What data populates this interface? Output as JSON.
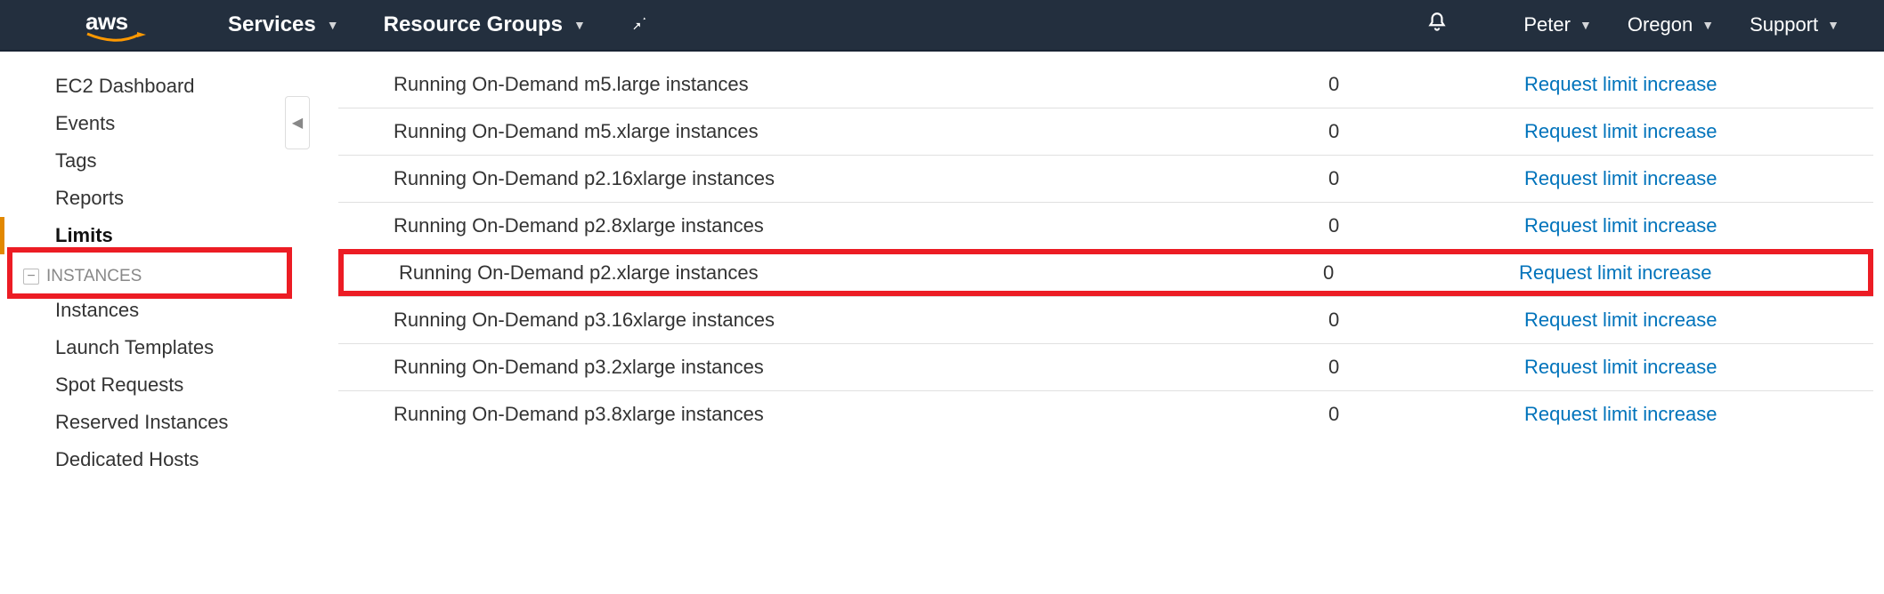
{
  "header": {
    "logo_text": "aws",
    "services": "Services",
    "resource_groups": "Resource Groups",
    "user": "Peter",
    "region": "Oregon",
    "support": "Support"
  },
  "sidebar": {
    "items": [
      "EC2 Dashboard",
      "Events",
      "Tags",
      "Reports",
      "Limits"
    ],
    "active_index": 4,
    "section_label": "INSTANCES",
    "section_items": [
      "Instances",
      "Launch Templates",
      "Spot Requests",
      "Reserved Instances",
      "Dedicated Hosts"
    ]
  },
  "table": {
    "link_label": "Request limit increase",
    "rows": [
      {
        "name": "Running On-Demand m5.large instances",
        "value": "0",
        "highlight": false
      },
      {
        "name": "Running On-Demand m5.xlarge instances",
        "value": "0",
        "highlight": false
      },
      {
        "name": "Running On-Demand p2.16xlarge instances",
        "value": "0",
        "highlight": false
      },
      {
        "name": "Running On-Demand p2.8xlarge instances",
        "value": "0",
        "highlight": false
      },
      {
        "name": "Running On-Demand p2.xlarge instances",
        "value": "0",
        "highlight": true
      },
      {
        "name": "Running On-Demand p3.16xlarge instances",
        "value": "0",
        "highlight": false
      },
      {
        "name": "Running On-Demand p3.2xlarge instances",
        "value": "0",
        "highlight": false
      },
      {
        "name": "Running On-Demand p3.8xlarge instances",
        "value": "0",
        "highlight": false
      }
    ]
  }
}
